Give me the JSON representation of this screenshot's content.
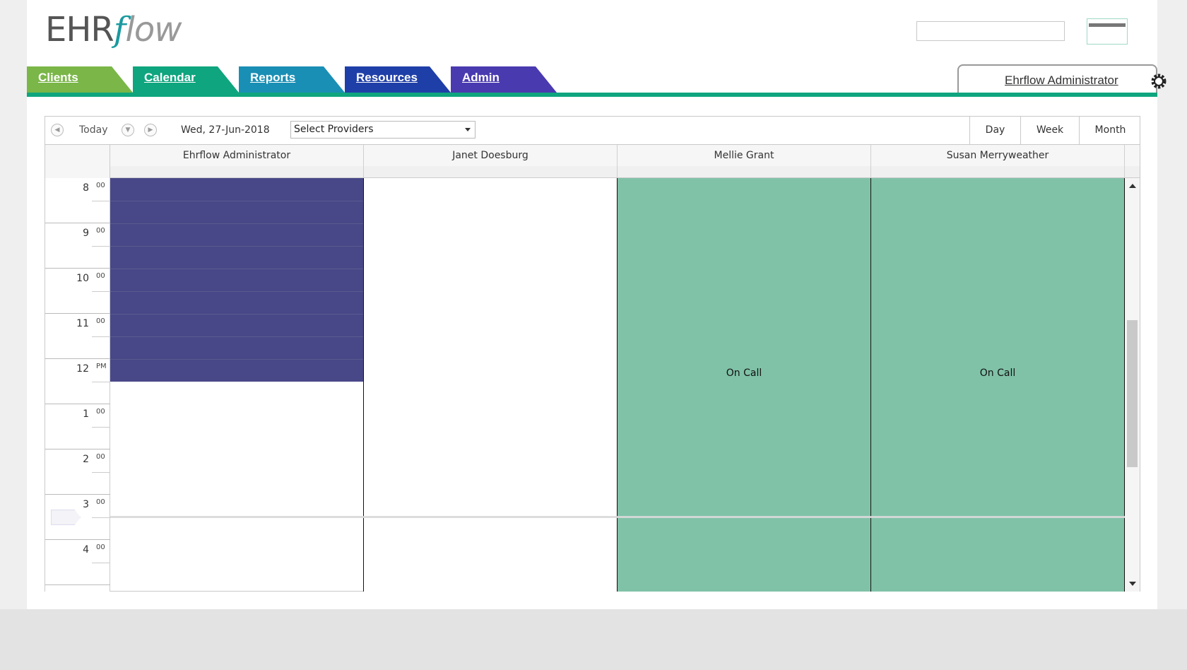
{
  "app": {
    "logo_ehr": "EHR",
    "logo_f": "f",
    "logo_low": "low"
  },
  "header": {
    "search_value": ""
  },
  "tabs": [
    {
      "label": "Clients",
      "color": "#7ab648"
    },
    {
      "label": "Calendar",
      "color": "#0fa57e"
    },
    {
      "label": "Reports",
      "color": "#1a8fb5"
    },
    {
      "label": "Resources",
      "color": "#1f3fa8"
    },
    {
      "label": "Admin",
      "color": "#4a3ab0"
    }
  ],
  "user": {
    "name": "Ehrflow Administrator",
    "icon": "gear-icon"
  },
  "toolbar": {
    "prev_icon": "chevron-left-icon",
    "today_label": "Today",
    "picker_icon": "chevron-down-icon",
    "next_icon": "chevron-right-icon",
    "date": "Wed, 27-Jun-2018",
    "providers_placeholder": "Select Providers",
    "views": [
      "Day",
      "Week",
      "Month"
    ]
  },
  "columns": [
    {
      "name": "Ehrflow Administrator"
    },
    {
      "name": "Janet Doesburg"
    },
    {
      "name": "Mellie Grant"
    },
    {
      "name": "Susan Merryweather"
    }
  ],
  "hours": [
    {
      "hour": "8",
      "suffix": "00"
    },
    {
      "hour": "9",
      "suffix": "00"
    },
    {
      "hour": "10",
      "suffix": "00"
    },
    {
      "hour": "11",
      "suffix": "00"
    },
    {
      "hour": "12",
      "suffix": "PM"
    },
    {
      "hour": "1",
      "suffix": "00"
    },
    {
      "hour": "2",
      "suffix": "00"
    },
    {
      "hour": "3",
      "suffix": "00"
    },
    {
      "hour": "4",
      "suffix": "00"
    }
  ],
  "events": {
    "mellie": "On Call",
    "susan": "On Call"
  },
  "colors": {
    "busy": "#484888",
    "on_call": "#80c2a8",
    "accent": "#0fa57e"
  }
}
